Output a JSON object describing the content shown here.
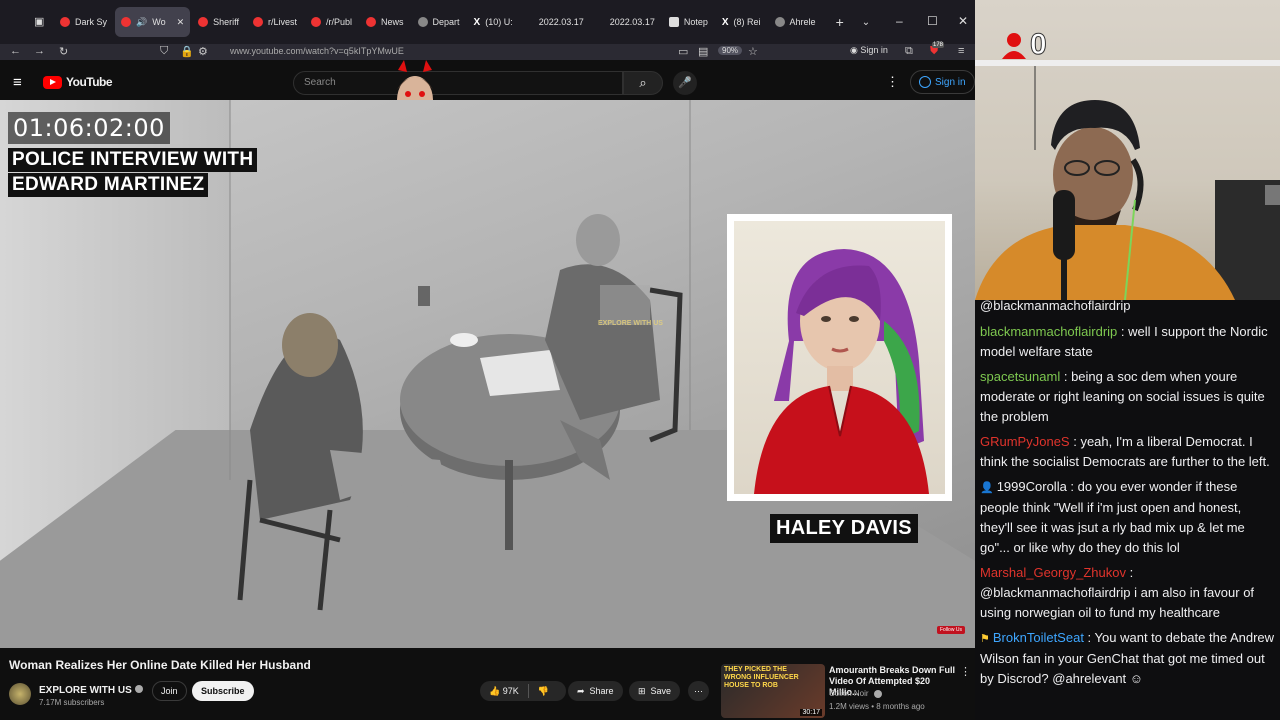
{
  "browser": {
    "tabs": [
      {
        "label": "Dark Sy",
        "active": false
      },
      {
        "label": "Wo",
        "active": true
      },
      {
        "label": "Sheriff",
        "active": false
      },
      {
        "label": "r/Livest",
        "active": false
      },
      {
        "label": "/r/Publ",
        "active": false
      },
      {
        "label": "News",
        "active": false
      },
      {
        "label": "Depart",
        "active": false
      },
      {
        "label": "(10) U:",
        "active": false
      },
      {
        "label": "2022.03.17",
        "active": false
      },
      {
        "label": "2022.03.17",
        "active": false
      },
      {
        "label": "Notep",
        "active": false
      },
      {
        "label": "(8) Rei",
        "active": false
      },
      {
        "label": "Ahrele",
        "active": false
      }
    ],
    "url": "www.youtube.com/watch?v=q5kITpYMwUE",
    "zoom": "90%",
    "signin": "Sign in",
    "ext_badge": "178"
  },
  "youtube": {
    "logo": "YouTube",
    "search_placeholder": "Search",
    "signin": "Sign in",
    "video": {
      "timecode": "01:06:02:00",
      "title_line1": "POLICE INTERVIEW WITH",
      "title_line2": "EDWARD MARTINEZ",
      "name_label": "HALEY DAVIS",
      "watermark": "EXPLORE WITH US",
      "follow": "Follow Us"
    },
    "title": "Woman Realizes Her Online Date Killed Her Husband",
    "channel": {
      "name": "EXPLORE WITH US",
      "subscribers": "7.17M subscribers"
    },
    "join": "Join",
    "subscribe": "Subscribe",
    "likes": "97K",
    "share": "Share",
    "save": "Save",
    "recommended": {
      "thumb_text": "THEY PICKED THE WRONG INFLUENCER HOUSE TO ROB",
      "duration": "30:17",
      "title": "Amouranth Breaks Down Full Video Of Attempted $20 Millio...",
      "channel": "Colion Noir",
      "meta": "1.2M views • 8 months ago"
    }
  },
  "stream": {
    "counter": "0",
    "chat": [
      {
        "user": "",
        "color": "#efeff1",
        "text": "@blackmanmachoflairdrip",
        "badge": ""
      },
      {
        "user": "blackmanmachoflairdrip",
        "color": "#7ec850",
        "text": "well I support the Nordic model welfare state",
        "badge": ""
      },
      {
        "user": "spacetsunaml",
        "color": "#7ec850",
        "text": "being a soc dem when youre moderate or right leaning on social issues is quite the problem",
        "badge": ""
      },
      {
        "user": "GRumPyJoneS",
        "color": "#e0342c",
        "text": "yeah, I'm a liberal Democrat. I think the socialist Democrats are further to the left.",
        "badge": ""
      },
      {
        "user": "1999Corolla",
        "color": "#efeff1",
        "text": "do you ever wonder if these people think \"Well if i'm just open and honest, they'll see it was jsut a rly bad mix up & let me go\"... or like why do they do this lol",
        "badge": "person"
      },
      {
        "user": "Marshal_Georgy_Zhukov",
        "color": "#e0342c",
        "text": "@blackmanmachoflairdrip i am also in favour of using norwegian oil to fund my healthcare",
        "badge": ""
      },
      {
        "user": "BroknToiletSeat",
        "color": "#3ea6ff",
        "text": "You want to debate the Andrew Wilson fan in your GenChat that got me timed out by Discrod? @ahrelevant",
        "badge": "flag"
      }
    ]
  }
}
